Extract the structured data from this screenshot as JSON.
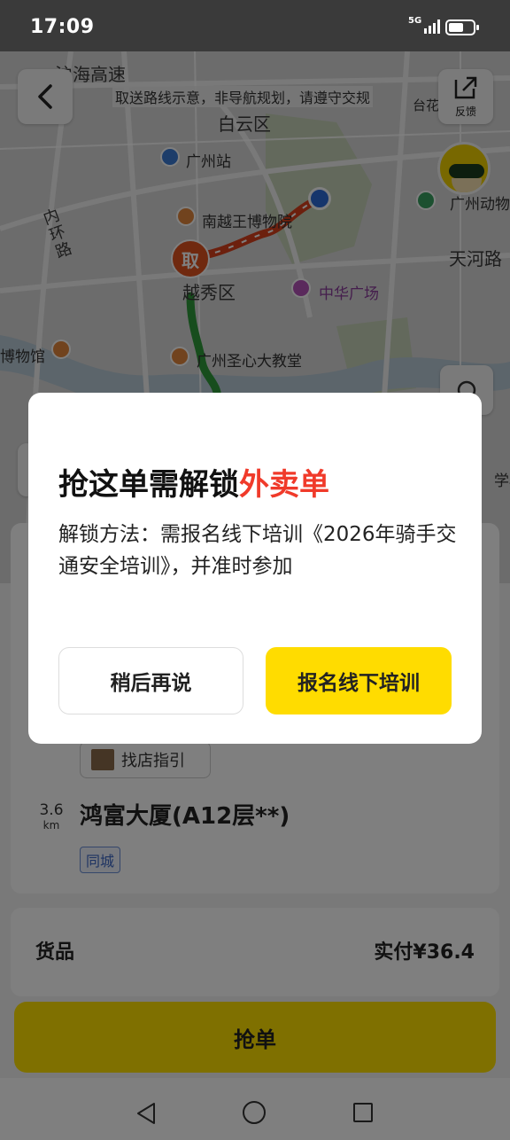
{
  "status_bar": {
    "time": "17:09",
    "network": "5G",
    "battery_level": 0.6
  },
  "map": {
    "route_hint": "取送路线示意，非导航规划，请遵守交规",
    "feedback_label": "反馈",
    "pickup_label": "取",
    "labels": {
      "zhuhai_highway": "沪海高速",
      "baiyun": "白云区",
      "guangzhou_station": "广州站",
      "nanyue_museum": "南越王博物院",
      "inner_ring": "内环路",
      "tianhe_road": "天河路",
      "yuexiu": "越秀区",
      "zhonghua_plaza": "中华广场",
      "museum": "博物馆",
      "sacred_heart": "广州圣心大教堂",
      "zoo": "广州动物",
      "taihua": "台花园",
      "school": "学校"
    }
  },
  "dialog": {
    "title_prefix": "抢这单需解锁",
    "title_highlight": "外卖单",
    "message": "解锁方法：需报名线下培训《2026年骑手交通安全培训》，并准时参加",
    "later_button": "稍后再说",
    "signup_button": "报名线下培训"
  },
  "order": {
    "guide_button": "找店指引",
    "distance_value": "3.6",
    "distance_unit": "km",
    "destination": "鸿富大厦(A12层**)",
    "tag": "同城",
    "goods_label": "货品",
    "paid_amount": "实付¥36.4",
    "grab_button": "抢单"
  },
  "colors": {
    "accent_yellow": "#ffdc00",
    "highlight_red": "#f03a2a",
    "route_green": "#2f9a3a",
    "route_red": "#d8401d",
    "tag_blue": "#3c67c5"
  }
}
